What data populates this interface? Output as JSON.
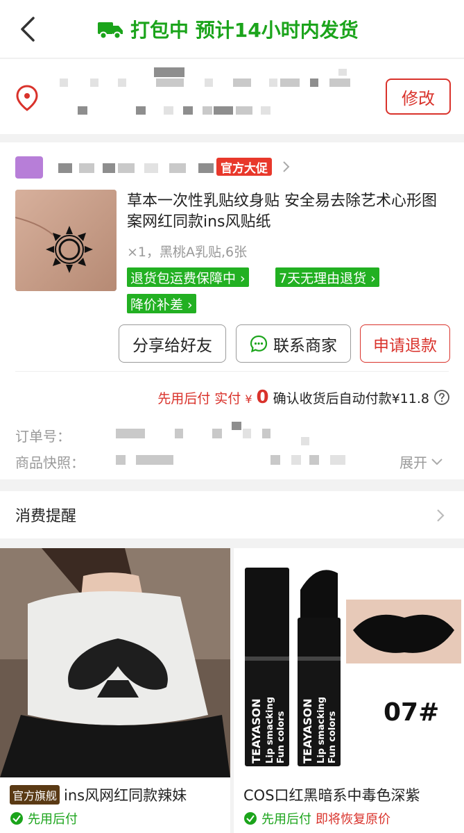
{
  "header": {
    "status": "打包中 预计14小时内发货",
    "back_icon": "chevron-left-icon",
    "truck_icon": "truck-icon",
    "accent": "#1ba41b"
  },
  "address": {
    "icon": "location-pin-icon",
    "modify_label": "修改"
  },
  "order": {
    "shop": {
      "promo_tag": "官方大促"
    },
    "product": {
      "title": "草本一次性乳贴纹身贴 安全易去除艺术心形图案网红同款ins风贴纸",
      "spec": "×1，黑桃A乳贴,6张",
      "tags": [
        "退货包运费保障中 ›",
        "7天无理由退货 ›",
        "降价补差 ›"
      ]
    },
    "actions": {
      "share": "分享给好友",
      "contact": "联系商家",
      "refund": "申请退款"
    },
    "payment": {
      "label": "先用后付 实付",
      "currency": "¥",
      "amount": "0",
      "auto_pay": "确认收货后自动付款¥11.8"
    },
    "order_no_label": "订单号：",
    "snapshot_label": "商品快照：",
    "expand_label": "展开"
  },
  "reminder": {
    "title": "消费提醒"
  },
  "recommendations": [
    {
      "flag": "官方旗舰",
      "title": "ins风网红同款辣妹",
      "pay_later": "先用后付",
      "extra": ""
    },
    {
      "flag": "",
      "title": "COS口红黑暗系中毒色深紫",
      "pay_later": "先用后付",
      "extra": "即将恢复原价",
      "image_text": "07#",
      "brand": "TEAYASON",
      "brand_sub": "Lip smacking",
      "brand_sub2": "Fun colors"
    }
  ],
  "colors": {
    "green": "#1ba41b",
    "red": "#d9322b",
    "tag_green": "#22b022"
  }
}
